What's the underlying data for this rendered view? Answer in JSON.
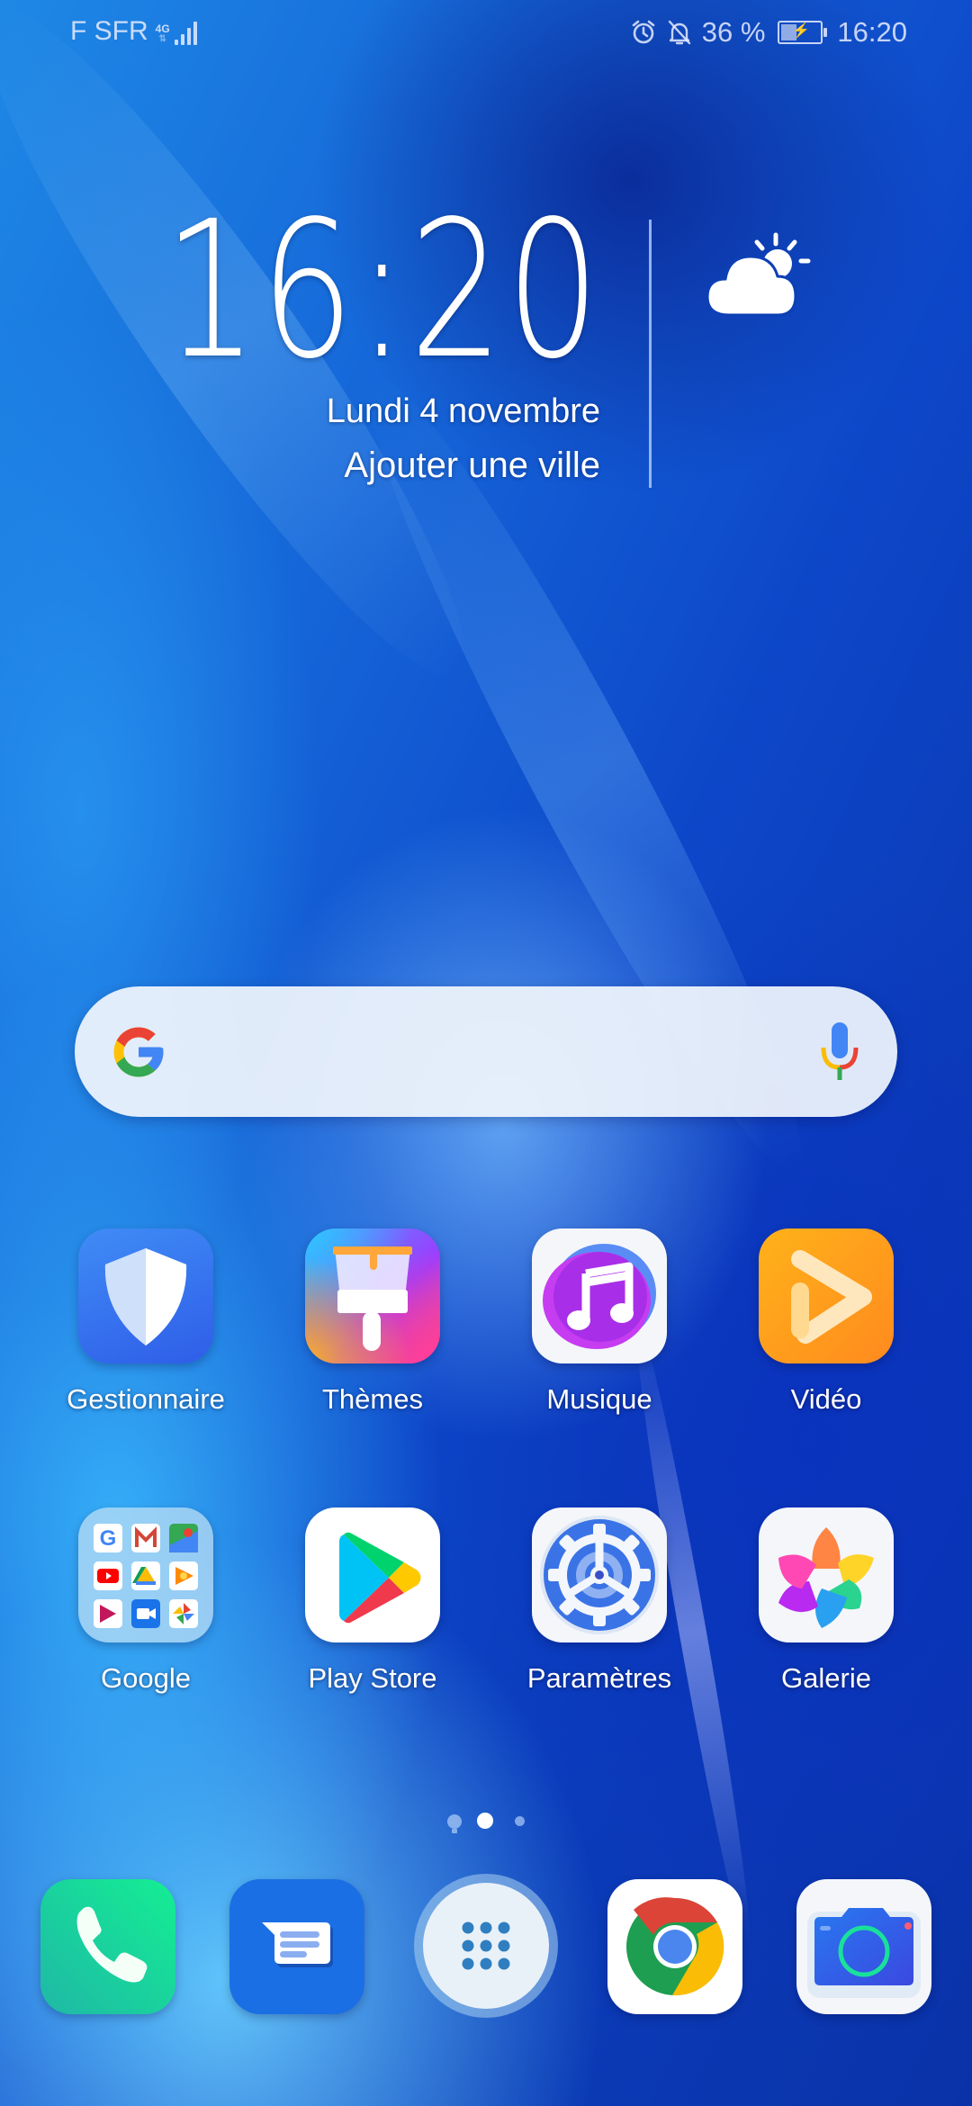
{
  "status_bar": {
    "carrier": "F SFR",
    "network_type": "4G",
    "signal_bars": 4,
    "alarm_icon": "alarm-clock-icon",
    "notifications_muted_icon": "bell-off-icon",
    "battery_percent": "36 %",
    "battery_level": 0.36,
    "charging": true,
    "time": "16:20"
  },
  "clock_widget": {
    "time": "16:20",
    "date": "Lundi 4 novembre",
    "city_prompt": "Ajouter une ville",
    "weather_icon": "partly-cloudy-icon"
  },
  "search_widget": {
    "logo": "google-g-icon",
    "voice_icon": "microphone-icon"
  },
  "apps_row1": [
    {
      "label": "Gestionnaire",
      "icon": "shield-icon"
    },
    {
      "label": "Thèmes",
      "icon": "paintbrush-icon"
    },
    {
      "label": "Musique",
      "icon": "music-note-icon"
    },
    {
      "label": "Vidéo",
      "icon": "play-icon"
    }
  ],
  "apps_row2": [
    {
      "label": "Google",
      "icon": "folder-icon",
      "folder_apps": [
        "Google",
        "Gmail",
        "Maps",
        "YouTube",
        "Drive",
        "Play Musique",
        "Play Films",
        "Duo",
        "Photos"
      ]
    },
    {
      "label": "Play Store",
      "icon": "play-store-icon"
    },
    {
      "label": "Paramètres",
      "icon": "settings-gear-icon"
    },
    {
      "label": "Galerie",
      "icon": "gallery-flower-icon"
    }
  ],
  "page_indicator": {
    "pages": 3,
    "current": 2,
    "first_page_icon": "lightbulb-icon"
  },
  "dock": [
    {
      "name": "Téléphone",
      "icon": "phone-icon"
    },
    {
      "name": "Messages",
      "icon": "message-icon"
    },
    {
      "name": "Applications",
      "icon": "app-drawer-icon"
    },
    {
      "name": "Chrome",
      "icon": "chrome-icon"
    },
    {
      "name": "Appareil photo",
      "icon": "camera-icon"
    }
  ]
}
